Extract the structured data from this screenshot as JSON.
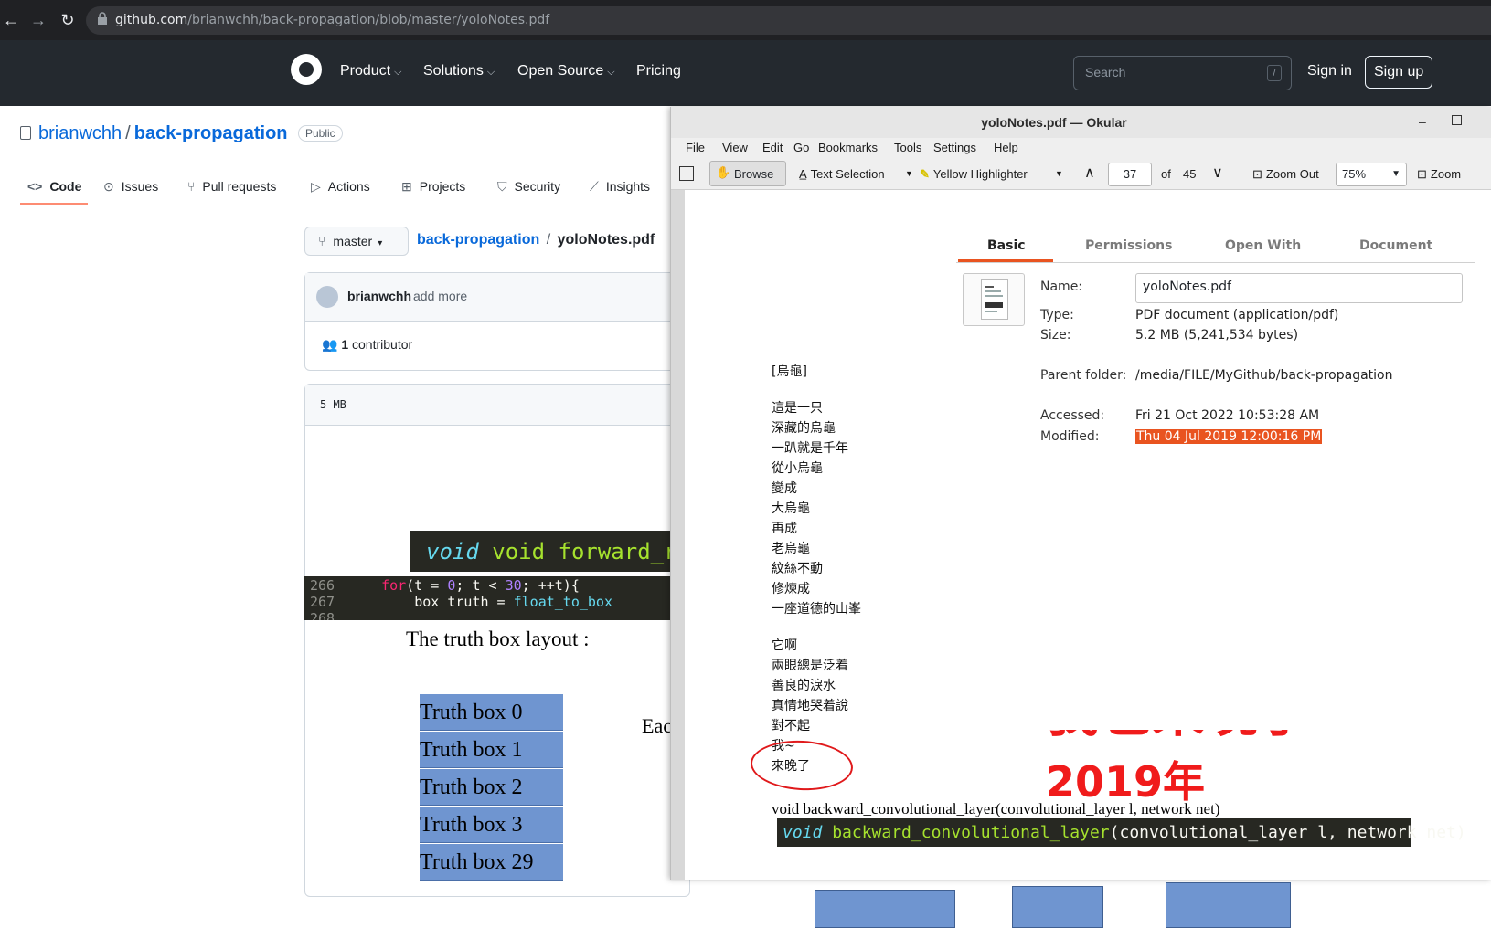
{
  "browser": {
    "url_host": "github.com",
    "url_path": "/brianwchh/back-propagation/blob/master/yoloNotes.pdf"
  },
  "github": {
    "nav": [
      "Product",
      "Solutions",
      "Open Source",
      "Pricing"
    ],
    "search_placeholder": "Search",
    "search_shortcut": "/",
    "sign_in": "Sign in",
    "sign_up": "Sign up",
    "repo_owner": "brianwchh",
    "repo_separator": "/",
    "repo_name": "back-propagation",
    "visibility": "Public",
    "tabs": [
      "Code",
      "Issues",
      "Pull requests",
      "Actions",
      "Projects",
      "Security",
      "Insights"
    ],
    "tab_icons": [
      "code-icon",
      "issue-icon",
      "pull-request-icon",
      "play-icon",
      "table-icon",
      "shield-icon",
      "graph-icon"
    ],
    "active_tab": "Code",
    "branch": "master",
    "breadcrumb_repo": "back-propagation",
    "breadcrumb_sep": "/",
    "breadcrumb_file": "yoloNotes.pdf",
    "commit_author": "brianwchh",
    "commit_message": "add more",
    "contributors_count": "1",
    "contributors_label": "contributor",
    "file_size": "5 MB"
  },
  "pdf_preview": {
    "code_large": "void forward_regio",
    "code_lines": [
      {
        "num": "266",
        "text": "    for(t = 0; t < 30; ++t){"
      },
      {
        "num": "267",
        "text": "        box truth = float_to_box"
      },
      {
        "num": "268",
        "text": ""
      }
    ],
    "truth_layout_label": "The truth box layout :",
    "truth_boxes": [
      "Truth box 0",
      "Truth box 1",
      "Truth box 2",
      "Truth box 3",
      "Truth box 29"
    ],
    "side_text": "Eac"
  },
  "okular": {
    "title": "yoloNotes.pdf — Okular",
    "menu": [
      "File",
      "View",
      "Edit",
      "Go",
      "Bookmarks",
      "Tools",
      "Settings",
      "Help"
    ],
    "toolbar": {
      "browse": "Browse",
      "text_selection": "Text Selection",
      "highlighter": "Yellow Highlighter",
      "page": "37",
      "of_label": "of",
      "total_pages": "45",
      "zoom_out": "Zoom Out",
      "zoom_value": "75%",
      "zoom_in": "Zoom"
    },
    "poem": [
      "[烏龜]",
      "",
      "這是一只",
      "深藏的烏龜",
      "一趴就是千年",
      "從小烏龜",
      "變成",
      "大烏龜",
      "再成",
      "老烏龜",
      "紋絲不動",
      "修煉成",
      "一座道德的山峯",
      "",
      "它啊",
      "兩眼總是泛着",
      "善良的淚水",
      "真情地哭着說",
      "對不起",
      "我~",
      "來晚了"
    ],
    "big_red_1": "我也來晚了",
    "big_red_2": "2019年",
    "backward_text": "void backward_convolutional_layer(convolutional_layer l, network net)",
    "backward_code": "void backward_convolutional_layer(convolutional_layer l, network net)"
  },
  "properties": {
    "tabs": [
      "Basic",
      "Permissions",
      "Open With",
      "Document"
    ],
    "active_tab": "Basic",
    "name_label": "Name:",
    "name_value": "yoloNotes.pdf",
    "type_label": "Type:",
    "type_value": "PDF document (application/pdf)",
    "size_label": "Size:",
    "size_value": "5.2 MB (5,241,534 bytes)",
    "parent_label": "Parent folder:",
    "parent_value": "/media/FILE/MyGithub/back-propagation",
    "accessed_label": "Accessed:",
    "accessed_value": "Fri 21 Oct 2022 10:53:28 AM",
    "modified_label": "Modified:",
    "modified_value": "Thu 04 Jul 2019 12:00:16 PM",
    "highlight_color": "#e95420"
  }
}
